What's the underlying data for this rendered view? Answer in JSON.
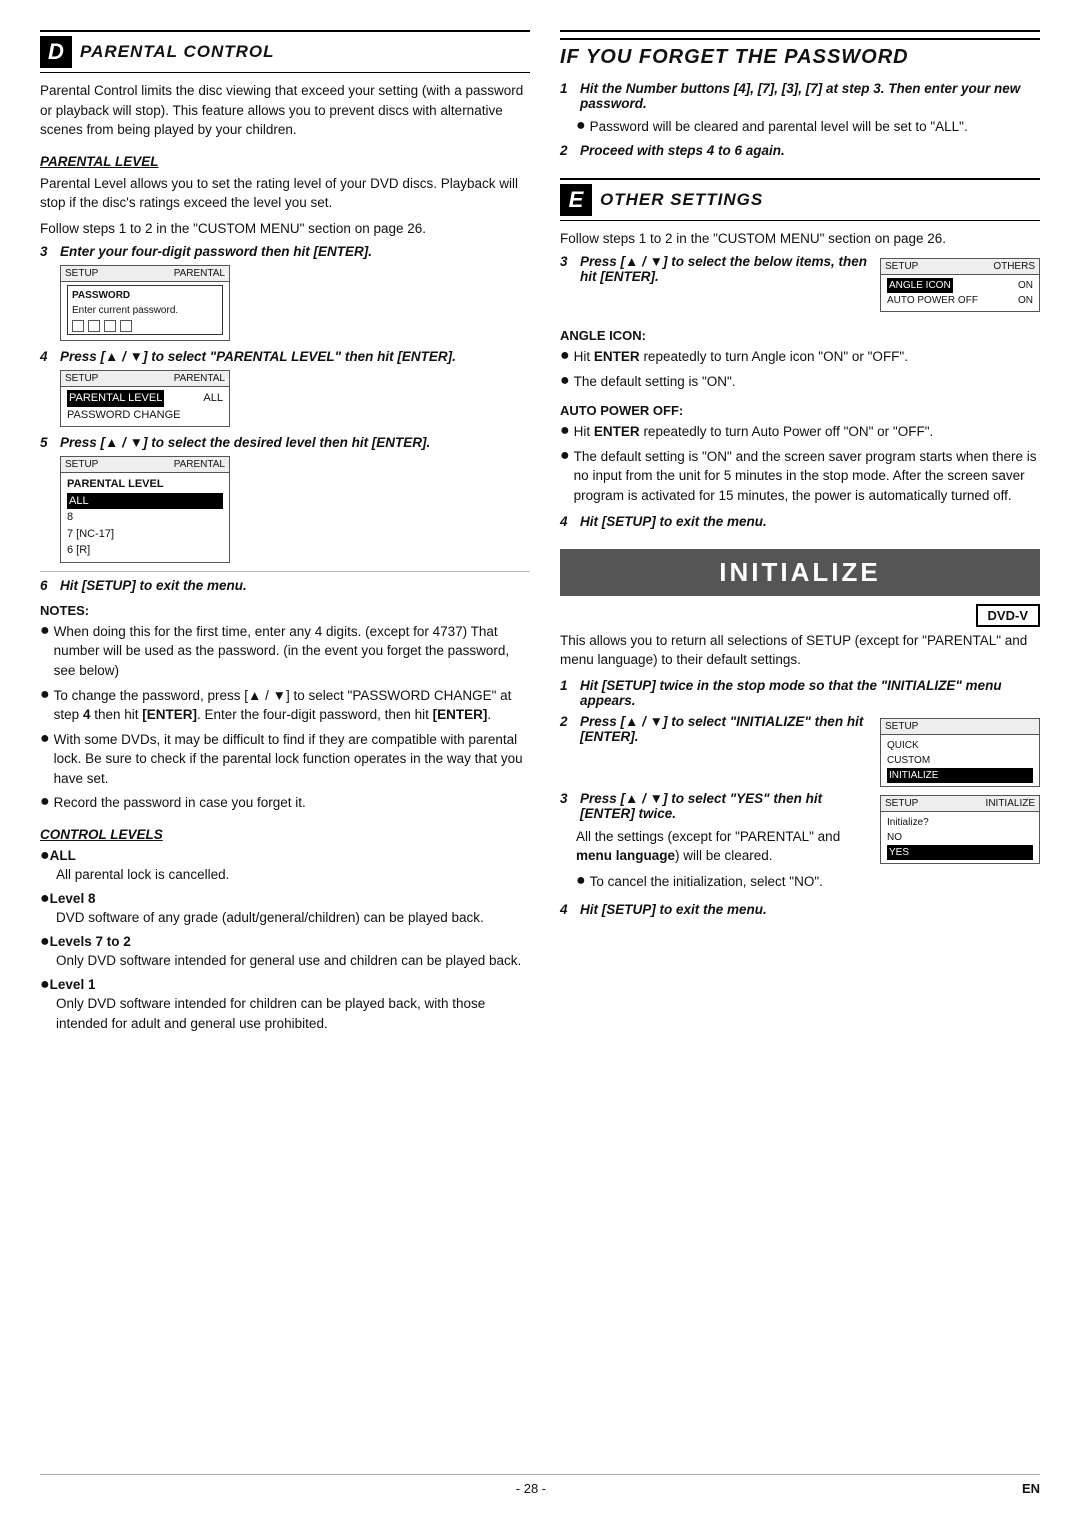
{
  "page": {
    "footer": {
      "page_num": "- 28 -",
      "lang": "EN"
    }
  },
  "section_d": {
    "letter": "D",
    "title": "PARENTAL CONTROL",
    "intro": "Parental Control limits the disc viewing that exceed your setting (with a password or playback will stop). This feature allows you to prevent discs with alternative scenes from being played by your children.",
    "parental_level": {
      "header": "PARENTAL LEVEL",
      "body": "Parental Level allows you to set the rating level of your DVD discs. Playback will stop if the disc's ratings exceed the level you set.",
      "follow_steps": "Follow steps 1 to 2 in the \"CUSTOM MENU\" section on page 26.",
      "step3": {
        "num": "3",
        "text": "Enter your four-digit password then hit [ENTER].",
        "screen": {
          "header_left": "SETUP",
          "header_right": "PARENTAL",
          "title": "PASSWORD",
          "subtitle": "Enter current password.",
          "squares": 4
        }
      },
      "step4": {
        "num": "4",
        "text": "Press [▲ / ▼] to select \"PARENTAL LEVEL\" then hit [ENTER].",
        "screen": {
          "header_left": "SETUP",
          "header_right": "PARENTAL",
          "row1": "PARENTAL LEVEL",
          "row1_val": "ALL",
          "row2": "PASSWORD CHANGE"
        }
      },
      "step5": {
        "num": "5",
        "text": "Press [▲ / ▼] to select the desired level then hit [ENTER].",
        "screen": {
          "header_left": "SETUP",
          "header_right": "PARENTAL",
          "title": "PARENTAL LEVEL",
          "rows": [
            "ALL",
            "8",
            "7 [NC-17]",
            "6 [R]"
          ]
        }
      },
      "step6": {
        "num": "6",
        "text": "Hit [SETUP] to exit the menu."
      }
    },
    "notes": {
      "title": "NOTES:",
      "items": [
        "When doing this for the first time, enter any 4 digits. (except for 4737) That number will be used as the password. (in the event you forget the password, see below)",
        "To change the password, press [▲ / ▼] to select \"PASSWORD CHANGE\" at step 4 then hit [ENTER]. Enter the four-digit password, then hit [ENTER].",
        "With some DVDs, it may be difficult to find if they are compatible with parental lock. Be sure to check if the parental lock function operates in the way that you have set.",
        "Record the password in case you forget it."
      ]
    },
    "control_levels": {
      "header": "CONTROL LEVELS",
      "levels": [
        {
          "label": "ALL",
          "text": "All parental lock is cancelled."
        },
        {
          "label": "Level 8",
          "text": "DVD software of any grade (adult/general/children) can be played back."
        },
        {
          "label": "Levels 7 to 2",
          "text": "Only DVD software intended for general use and children can be played back."
        },
        {
          "label": "Level 1",
          "text": "Only DVD software intended for children can be played back, with those intended for adult and general use prohibited."
        }
      ]
    }
  },
  "if_forget": {
    "title": "IF YOU FORGET THE PASSWORD",
    "step1": {
      "num": "1",
      "text": "Hit the Number buttons [4], [7], [3], [7] at step 3. Then enter your new password.",
      "bullet": "Password will be cleared and parental level will be set to \"ALL\"."
    },
    "step2": {
      "num": "2",
      "text": "Proceed with steps 4 to 6 again."
    }
  },
  "section_e": {
    "letter": "E",
    "title": "OTHER SETTINGS",
    "follow_steps": "Follow steps 1 to 2 in the \"CUSTOM MENU\" section on page 26.",
    "step3": {
      "num": "3",
      "text": "Press [▲ / ▼] to select the below items, then hit [ENTER].",
      "screen": {
        "header_left": "SETUP",
        "header_right": "OTHERS",
        "row1": "ANGLE ICON",
        "row1_val": "ON",
        "row2": "AUTO POWER OFF",
        "row2_val": "ON"
      }
    },
    "angle_icon": {
      "header": "ANGLE ICON:",
      "bullets": [
        "Hit ENTER repeatedly to turn Angle icon \"ON\" or \"OFF\".",
        "The default setting is \"ON\"."
      ]
    },
    "auto_power_off": {
      "header": "AUTO POWER OFF:",
      "bullets": [
        "Hit ENTER repeatedly to turn Auto Power off \"ON\" or \"OFF\".",
        "The default setting is \"ON\" and the screen saver program starts when there is no input from the unit for 5 minutes in the stop mode. After the screen saver program is activated for 15 minutes, the power is automatically turned off."
      ]
    },
    "step4": {
      "num": "4",
      "text": "Hit [SETUP] to exit the menu."
    }
  },
  "initialize": {
    "banner": "INITIALIZE",
    "badge": "DVD-V",
    "intro": "This allows you to return all selections of SETUP (except for \"PARENTAL\" and menu language) to their default settings.",
    "step1": {
      "num": "1",
      "text": "Hit [SETUP] twice in the stop mode so that the \"INITIALIZE\" menu appears."
    },
    "step2": {
      "num": "2",
      "text": "Press [▲ / ▼] to select \"INITIALIZE\" then hit [ENTER].",
      "screen": {
        "rows": [
          "QUICK",
          "CUSTOM",
          "INITIALIZE"
        ]
      }
    },
    "step3": {
      "num": "3",
      "text": "Press [▲ / ▼] to select \"YES\" then hit [ENTER] twice.",
      "body_text": "All the settings (except for \"PARENTAL\" and menu language) will be cleared.",
      "bullet": "To cancel the initialization, select \"NO\".",
      "screen": {
        "header_left": "SETUP",
        "header_right": "INITIALIZE",
        "rows": [
          "Initialize?",
          "NO",
          "YES"
        ]
      }
    },
    "step4": {
      "num": "4",
      "text": "Hit [SETUP] to exit the menu."
    }
  }
}
